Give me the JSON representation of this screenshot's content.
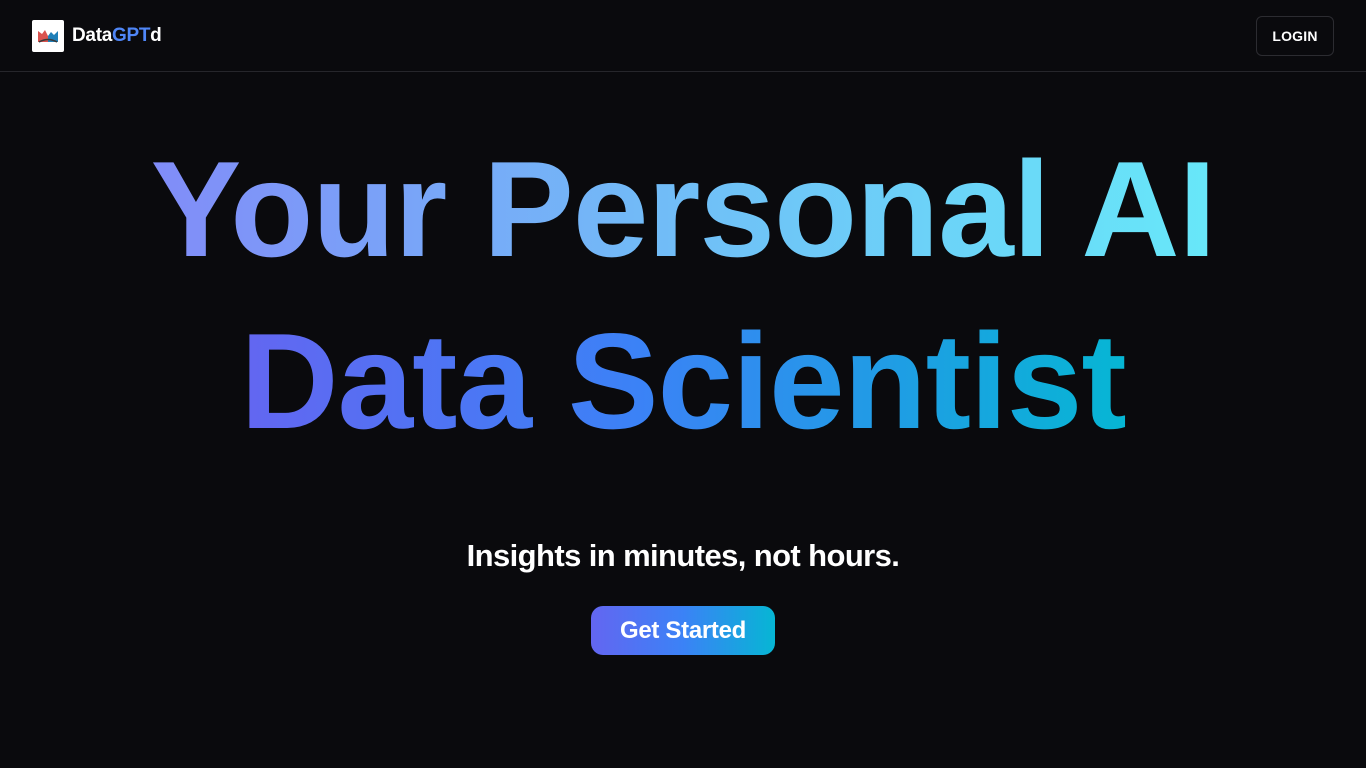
{
  "header": {
    "brand": {
      "part1": "Data",
      "part2": "GPT",
      "part3": "d"
    },
    "login_label": "LOGIN"
  },
  "hero": {
    "line1": "Your Personal AI",
    "line2": "Data Scientist",
    "tagline": "Insights in minutes, not hours.",
    "cta_label": "Get Started"
  },
  "colors": {
    "background": "#0a0a0d",
    "brand_accent": "#4f86f7",
    "gradient_start": "#6366f1",
    "gradient_mid": "#3b82f6",
    "gradient_end": "#06b6d4"
  },
  "icons": {
    "logo": "chart-book-logo-icon"
  }
}
